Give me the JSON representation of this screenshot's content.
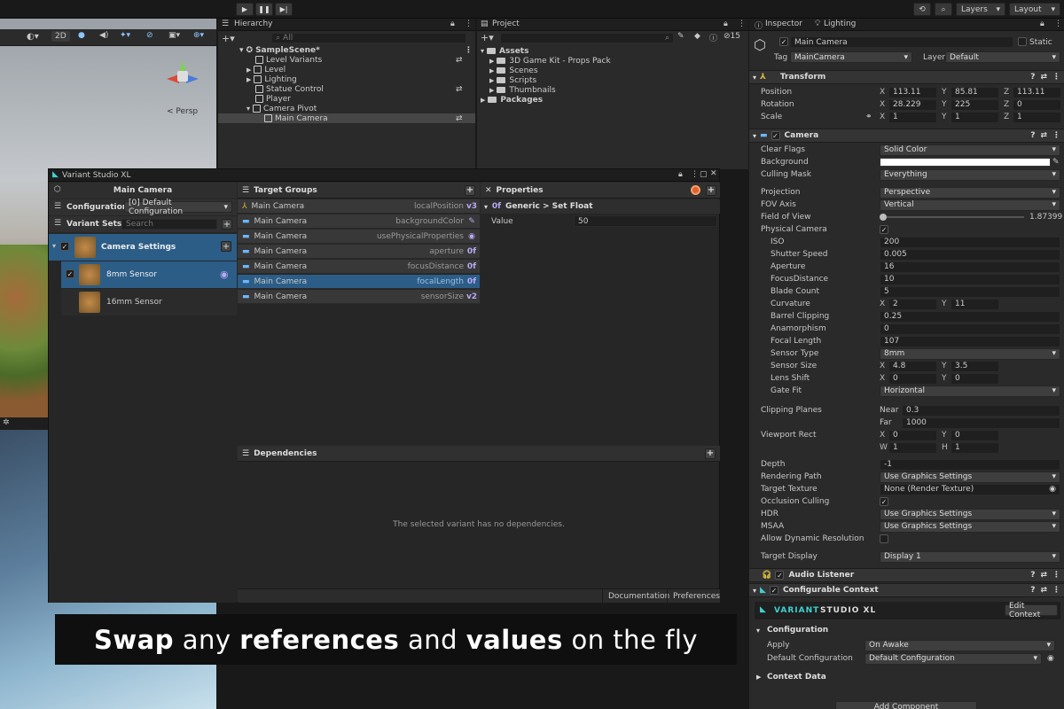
{
  "toolbar": {
    "layers": "Layers",
    "layout": "Layout"
  },
  "scene": {
    "mode_2d": "2D",
    "persp": "< Persp"
  },
  "hierarchy": {
    "tab": "Hierarchy",
    "search_placeholder": "All",
    "items": [
      {
        "label": "SampleScene*",
        "depth": 0
      },
      {
        "label": "Level Variants",
        "depth": 1
      },
      {
        "label": "Level",
        "depth": 1
      },
      {
        "label": "Lighting",
        "depth": 1
      },
      {
        "label": "Statue Control",
        "depth": 1
      },
      {
        "label": "Player",
        "depth": 1
      },
      {
        "label": "Camera Pivot",
        "depth": 1
      },
      {
        "label": "Main Camera",
        "depth": 2
      }
    ]
  },
  "project": {
    "tab": "Project",
    "count": "15",
    "items": [
      {
        "label": "Assets",
        "depth": 0
      },
      {
        "label": "3D Game Kit - Props Pack",
        "depth": 1
      },
      {
        "label": "Scenes",
        "depth": 1
      },
      {
        "label": "Scripts",
        "depth": 1
      },
      {
        "label": "Thumbnails",
        "depth": 1
      },
      {
        "label": "Packages",
        "depth": 0
      }
    ]
  },
  "variant_studio": {
    "title": "Variant Studio XL",
    "object": "Main Camera",
    "configuration_label": "Configuration",
    "configuration_value": "[0] Default Configuration",
    "variant_sets_label": "Variant Sets",
    "search_placeholder": "Search",
    "set_name": "Camera Settings",
    "variants": [
      "8mm Sensor",
      "16mm Sensor"
    ],
    "target_groups_label": "Target Groups",
    "targets": [
      {
        "object": "Main Camera",
        "prop": "localPosition",
        "tag": "v3"
      },
      {
        "object": "Main Camera",
        "prop": "backgroundColor",
        "tag": "✎"
      },
      {
        "object": "Main Camera",
        "prop": "usePhysicalProperties",
        "tag": "◉"
      },
      {
        "object": "Main Camera",
        "prop": "aperture",
        "tag": "0f"
      },
      {
        "object": "Main Camera",
        "prop": "focusDistance",
        "tag": "0f"
      },
      {
        "object": "Main Camera",
        "prop": "focalLength",
        "tag": "0f"
      },
      {
        "object": "Main Camera",
        "prop": "sensorSize",
        "tag": "v2"
      }
    ],
    "properties_label": "Properties",
    "property_group": "Generic > Set Float",
    "value_label": "Value",
    "value": "50",
    "dependencies_label": "Dependencies",
    "no_deps": "The selected variant has no dependencies.",
    "documentation": "Documentation",
    "preferences": "Preferences"
  },
  "inspector": {
    "tab": "Inspector",
    "lighting_tab": "Lighting",
    "object_name": "Main Camera",
    "static_label": "Static",
    "tag_label": "Tag",
    "tag_value": "MainCamera",
    "layer_label": "Layer",
    "layer_value": "Default",
    "transform": {
      "title": "Transform",
      "position": [
        "113.11",
        "85.81",
        "113.11"
      ],
      "rotation": [
        "28.229",
        "225",
        "0"
      ],
      "scale": [
        "1",
        "1",
        "1"
      ]
    },
    "camera": {
      "title": "Camera",
      "clear_flags": "Solid Color",
      "culling_mask": "Everything",
      "projection": "Perspective",
      "fov_axis": "Vertical",
      "fov": "1.87399",
      "iso": "200",
      "shutter": "0.005",
      "aperture": "16",
      "focus_distance": "10",
      "blade_count": "5",
      "curvature": [
        "2",
        "11"
      ],
      "barrel": "0.25",
      "anamorphism": "0",
      "focal_length": "107",
      "sensor_type": "8mm",
      "sensor_size": [
        "4.8",
        "3.5"
      ],
      "lens_shift": [
        "0",
        "0"
      ],
      "gate_fit": "Horizontal",
      "near": "0.3",
      "far": "1000",
      "viewport": [
        "0",
        "0",
        "1",
        "1"
      ],
      "depth": "-1",
      "rendering_path": "Use Graphics Settings",
      "target_texture": "None (Render Texture)",
      "hdr": "Use Graphics Settings",
      "msaa": "Use Graphics Settings",
      "target_display": "Display 1"
    },
    "labels": {
      "position": "Position",
      "rotation": "Rotation",
      "scale": "Scale",
      "clear_flags": "Clear Flags",
      "background": "Background",
      "culling_mask": "Culling Mask",
      "projection": "Projection",
      "fov_axis": "FOV Axis",
      "fov": "Field of View",
      "physical": "Physical Camera",
      "iso": "ISO",
      "shutter": "Shutter Speed",
      "aperture": "Aperture",
      "focus_distance": "FocusDistance",
      "blade_count": "Blade Count",
      "curvature": "Curvature",
      "barrel": "Barrel Clipping",
      "anamorphism": "Anamorphism",
      "focal_length": "Focal Length",
      "sensor_type": "Sensor Type",
      "sensor_size": "Sensor Size",
      "lens_shift": "Lens Shift",
      "gate_fit": "Gate Fit",
      "clipping": "Clipping Planes",
      "near": "Near",
      "far": "Far",
      "viewport": "Viewport Rect",
      "depth": "Depth",
      "rendering_path": "Rendering Path",
      "target_texture": "Target Texture",
      "occlusion": "Occlusion Culling",
      "hdr": "HDR",
      "msaa": "MSAA",
      "dynres": "Allow Dynamic Resolution",
      "target_display": "Target Display"
    },
    "audio_listener": "Audio Listener",
    "configurable_context": "Configurable Context",
    "brand_a": "VARIANT",
    "brand_b": "STUDIO XL",
    "edit_context": "Edit Context",
    "cfg_section": "Configuration",
    "apply_label": "Apply",
    "apply_value": "On Awake",
    "default_cfg_label": "Default Configuration",
    "default_cfg_value": "Default Configuration",
    "context_data": "Context Data",
    "add_component": "Add Component"
  },
  "banner": {
    "w1": "Swap",
    "w2": "any",
    "w3": "references",
    "w4": "and",
    "w5": "values",
    "w6": "on the fly"
  }
}
